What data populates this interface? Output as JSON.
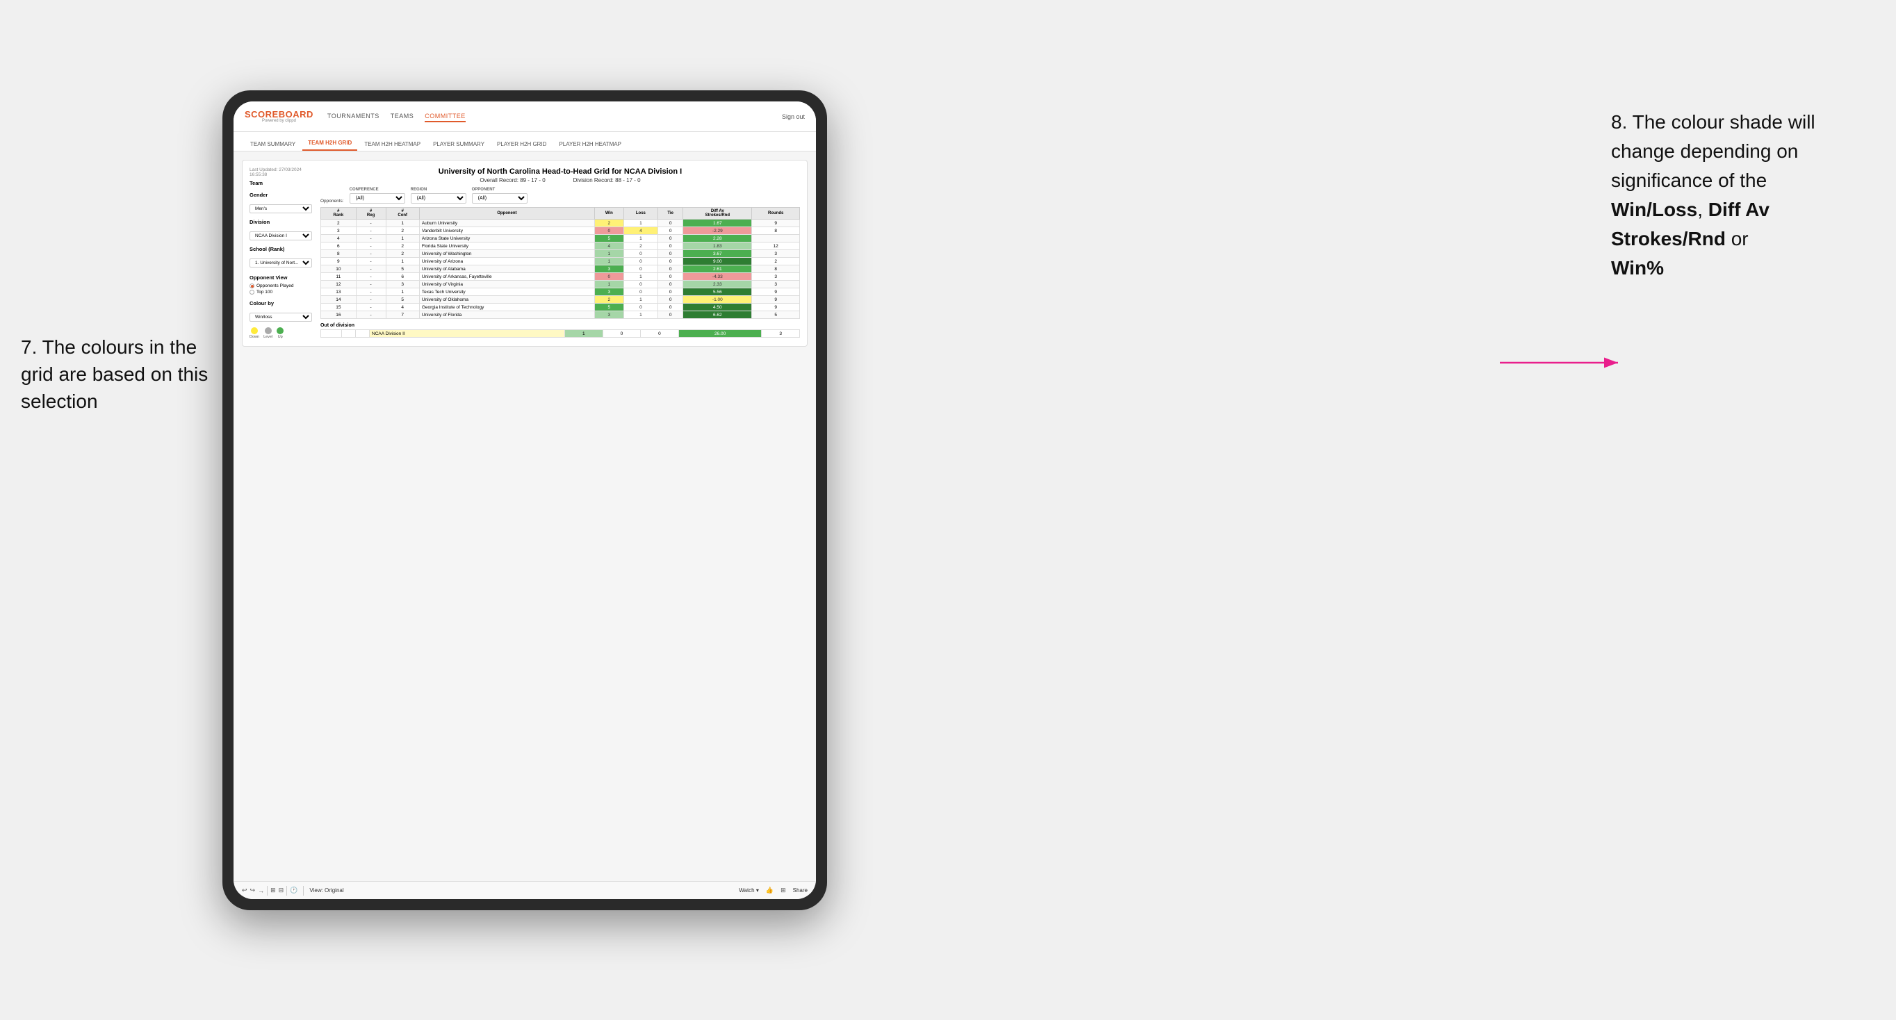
{
  "annotations": {
    "left_title": "7. The colours in the grid are based on this selection",
    "right_title": "8. The colour shade will change depending on significance of the",
    "right_bold1": "Win/Loss",
    "right_comma": ", ",
    "right_bold2": "Diff Av Strokes/Rnd",
    "right_or": " or",
    "right_bold3": "Win%"
  },
  "nav": {
    "logo": "SCOREBOARD",
    "logo_sub": "Powered by clippd",
    "links": [
      "TOURNAMENTS",
      "TEAMS",
      "COMMITTEE"
    ],
    "sign_out": "Sign out"
  },
  "sub_nav": {
    "links": [
      "TEAM SUMMARY",
      "TEAM H2H GRID",
      "TEAM H2H HEATMAP",
      "PLAYER SUMMARY",
      "PLAYER H2H GRID",
      "PLAYER H2H HEATMAP"
    ]
  },
  "report": {
    "timestamp": "Last Updated: 27/03/2024 16:55:38",
    "title": "University of North Carolina Head-to-Head Grid for NCAA Division I",
    "overall_record": "Overall Record: 89 - 17 - 0",
    "division_record": "Division Record: 88 - 17 - 0"
  },
  "filters": {
    "conference_label": "Conference",
    "conference_value": "(All)",
    "region_label": "Region",
    "region_value": "(All)",
    "opponent_label": "Opponent",
    "opponent_value": "(All)",
    "opponents_label": "Opponents:"
  },
  "sidebar": {
    "team_label": "Team",
    "gender_label": "Gender",
    "gender_value": "Men's",
    "division_label": "Division",
    "division_value": "NCAA Division I",
    "school_label": "School (Rank)",
    "school_value": "1. University of Nort...",
    "opponent_view_label": "Opponent View",
    "radio1": "Opponents Played",
    "radio2": "Top 100",
    "colour_by_label": "Colour by",
    "colour_by_value": "Win/loss",
    "legend_down": "Down",
    "legend_level": "Level",
    "legend_up": "Up"
  },
  "table": {
    "headers": [
      "#\nRank",
      "#\nReg",
      "#\nConf",
      "Opponent",
      "Win",
      "Loss",
      "Tie",
      "Diff Av\nStrokes/Rnd",
      "Rounds"
    ],
    "rows": [
      {
        "rank": "2",
        "reg": "-",
        "conf": "1",
        "opponent": "Auburn University",
        "win": "2",
        "loss": "1",
        "tie": "0",
        "diff": "1.67",
        "rounds": "9",
        "win_color": "yellow",
        "loss_color": "white",
        "diff_color": "green"
      },
      {
        "rank": "3",
        "reg": "-",
        "conf": "2",
        "opponent": "Vanderbilt University",
        "win": "0",
        "loss": "4",
        "tie": "0",
        "diff": "-2.29",
        "rounds": "8",
        "win_color": "red",
        "loss_color": "yellow",
        "diff_color": "red"
      },
      {
        "rank": "4",
        "reg": "-",
        "conf": "1",
        "opponent": "Arizona State University",
        "win": "5",
        "loss": "1",
        "tie": "0",
        "diff": "2.28",
        "rounds": "",
        "win_color": "green",
        "loss_color": "white",
        "diff_color": "green"
      },
      {
        "rank": "6",
        "reg": "-",
        "conf": "2",
        "opponent": "Florida State University",
        "win": "4",
        "loss": "2",
        "tie": "0",
        "diff": "1.83",
        "rounds": "12",
        "win_color": "light_green",
        "loss_color": "white",
        "diff_color": "light_green"
      },
      {
        "rank": "8",
        "reg": "-",
        "conf": "2",
        "opponent": "University of Washington",
        "win": "1",
        "loss": "0",
        "tie": "0",
        "diff": "3.67",
        "rounds": "3",
        "win_color": "light_green",
        "loss_color": "white",
        "diff_color": "green"
      },
      {
        "rank": "9",
        "reg": "-",
        "conf": "1",
        "opponent": "University of Arizona",
        "win": "1",
        "loss": "0",
        "tie": "0",
        "diff": "9.00",
        "rounds": "2",
        "win_color": "light_green",
        "loss_color": "white",
        "diff_color": "dark_green"
      },
      {
        "rank": "10",
        "reg": "-",
        "conf": "5",
        "opponent": "University of Alabama",
        "win": "3",
        "loss": "0",
        "tie": "0",
        "diff": "2.61",
        "rounds": "8",
        "win_color": "green",
        "loss_color": "white",
        "diff_color": "green"
      },
      {
        "rank": "11",
        "reg": "-",
        "conf": "6",
        "opponent": "University of Arkansas, Fayetteville",
        "win": "0",
        "loss": "1",
        "tie": "0",
        "diff": "-4.33",
        "rounds": "3",
        "win_color": "red",
        "loss_color": "white",
        "diff_color": "red"
      },
      {
        "rank": "12",
        "reg": "-",
        "conf": "3",
        "opponent": "University of Virginia",
        "win": "1",
        "loss": "0",
        "tie": "0",
        "diff": "2.33",
        "rounds": "3",
        "win_color": "light_green",
        "loss_color": "white",
        "diff_color": "light_green"
      },
      {
        "rank": "13",
        "reg": "-",
        "conf": "1",
        "opponent": "Texas Tech University",
        "win": "3",
        "loss": "0",
        "tie": "0",
        "diff": "5.56",
        "rounds": "9",
        "win_color": "green",
        "loss_color": "white",
        "diff_color": "dark_green"
      },
      {
        "rank": "14",
        "reg": "-",
        "conf": "5",
        "opponent": "University of Oklahoma",
        "win": "2",
        "loss": "1",
        "tie": "0",
        "diff": "-1.00",
        "rounds": "9",
        "win_color": "yellow",
        "loss_color": "white",
        "diff_color": "yellow"
      },
      {
        "rank": "15",
        "reg": "-",
        "conf": "4",
        "opponent": "Georgia Institute of Technology",
        "win": "5",
        "loss": "0",
        "tie": "0",
        "diff": "4.50",
        "rounds": "9",
        "win_color": "green",
        "loss_color": "white",
        "diff_color": "dark_green"
      },
      {
        "rank": "16",
        "reg": "-",
        "conf": "7",
        "opponent": "University of Florida",
        "win": "3",
        "loss": "1",
        "tie": "0",
        "diff": "6.62",
        "rounds": "5",
        "win_color": "light_green",
        "loss_color": "white",
        "diff_color": "dark_green"
      }
    ],
    "out_of_division_label": "Out of division",
    "out_of_division_row": {
      "name": "NCAA Division II",
      "win": "1",
      "loss": "0",
      "tie": "0",
      "diff": "26.00",
      "rounds": "3"
    }
  },
  "toolbar": {
    "view_label": "View: Original",
    "watch_label": "Watch ▾",
    "share_label": "Share"
  },
  "colors": {
    "dark_green": "#2e7d32",
    "medium_green": "#4caf50",
    "light_green": "#a5d6a7",
    "yellow": "#fff176",
    "orange": "#ffcc80",
    "red": "#ef9a9a",
    "dark_red": "#e53935",
    "pink_arrow": "#e91e8c"
  }
}
